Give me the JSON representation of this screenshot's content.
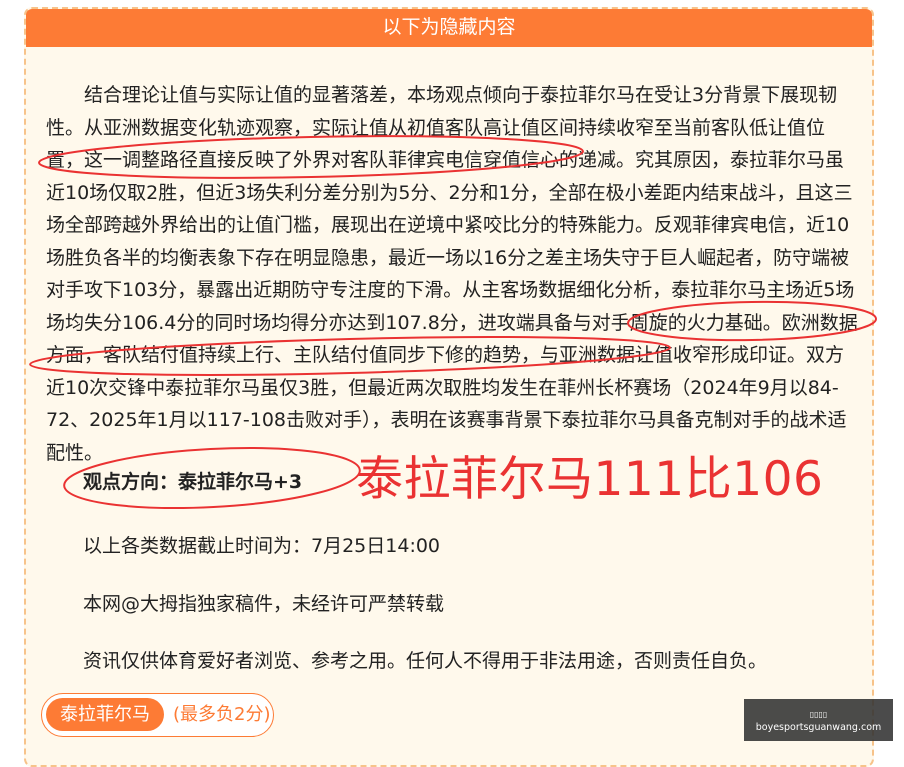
{
  "header": {
    "title": "以下为隐藏内容"
  },
  "article": {
    "paragraph": "结合理论让值与实际让值的显著落差，本场观点倾向于泰拉菲尔马在受让3分背景下展现韧性。从亚洲数据变化轨迹观察，实际让值从初值客队高让值区间持续收窄至当前客队低让值位置，这一调整路径直接反映了外界对客队菲律宾电信穿值信心的递减。究其原因，泰拉菲尔马虽近10场仅取2胜，但近3场失利分差分别为5分、2分和1分，全部在极小差距内结束战斗，且这三场全部跨越外界给出的让值门槛，展现出在逆境中紧咬比分的特殊能力。反观菲律宾电信，近10场胜负各半的均衡表象下存在明显隐患，最近一场以16分之差主场失守于巨人崛起者，防守端被对手攻下103分，暴露出近期防守专注度的下滑。从主客场数据细化分析，泰拉菲尔马主场近5场场均失分106.4分的同时场均得分亦达到107.8分，进攻端具备与对手周旋的火力基础。欧洲数据方面，客队结付值持续上行、主队结付值同步下修的趋势，与亚洲数据让值收窄形成印证。双方近10次交锋中泰拉菲尔马虽仅3胜，但最近两次取胜均发生在菲州长杯赛场（2024年9月以84-72、2025年1月以117-108击败对手），表明在该赛事背景下泰拉菲尔马具备克制对手的战术适配性。",
    "viewpoint": "观点方向：泰拉菲尔马+3",
    "score_annotation": "泰拉菲尔马111比106",
    "cutoff": "以上各类数据截止时间为：7月25日14:00",
    "copyright": "本网@大拇指独家稿件，未经许可严禁转载",
    "disclaimer": "资讯仅供体育爱好者浏览、参考之用。任何人不得用于非法用途，否则责任自负。"
  },
  "tag": {
    "label": "泰拉菲尔马",
    "note": "(最多负2分)"
  },
  "watermark": {
    "top": "▯▯▯▯",
    "domain": "boyesportsguanwang.com"
  },
  "colors": {
    "accent_orange": "#fd7b35",
    "card_background": "#fff9ec",
    "annotation_red": "#ea3232"
  }
}
